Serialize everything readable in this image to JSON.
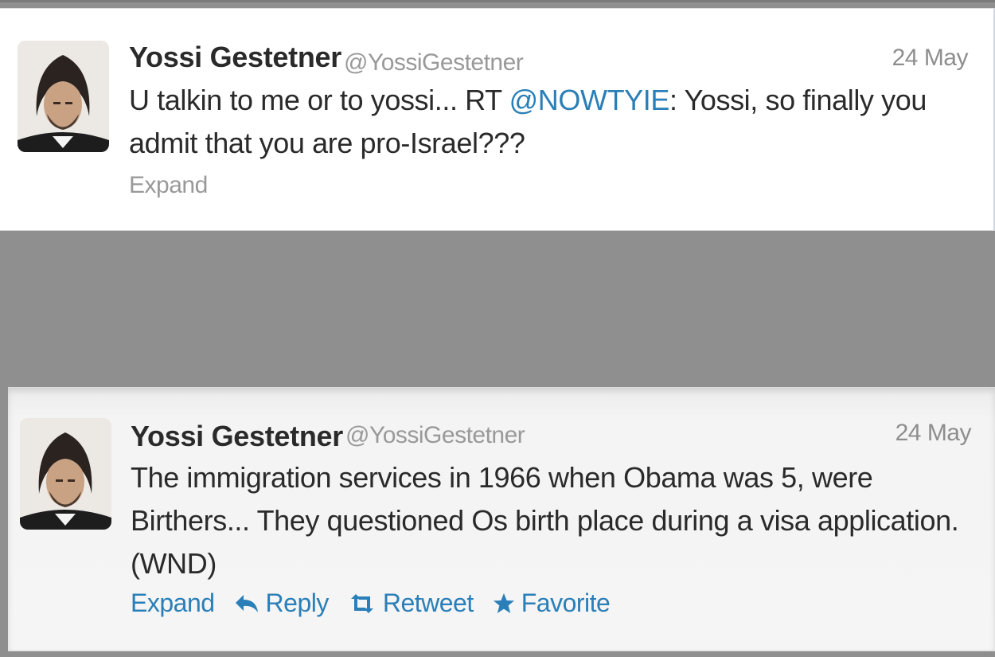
{
  "tweets": [
    {
      "name": "Yossi Gestetner",
      "handle": "@YossiGestetner",
      "date": "24 May",
      "text_before": "U talkin to me or to yossi... RT ",
      "mention": "@NOWTYIE",
      "text_after": ": Yossi, so finally you admit that you are pro-Israel???",
      "expand": "Expand"
    },
    {
      "name": "Yossi Gestetner",
      "handle": "@YossiGestetner",
      "date": "24 May",
      "text": "The immigration services in 1966 when Obama was 5, were Birthers... They questioned Os birth place during a visa application. (WND)",
      "actions": {
        "expand": "Expand",
        "reply": "Reply",
        "retweet": "Retweet",
        "favorite": "Favorite"
      }
    }
  ],
  "colors": {
    "link": "#2a7fb8",
    "muted": "#999999",
    "text": "#2a2a2a",
    "background_gap": "#8f8f8f"
  },
  "icons": [
    "reply-icon",
    "retweet-icon",
    "star-icon"
  ]
}
